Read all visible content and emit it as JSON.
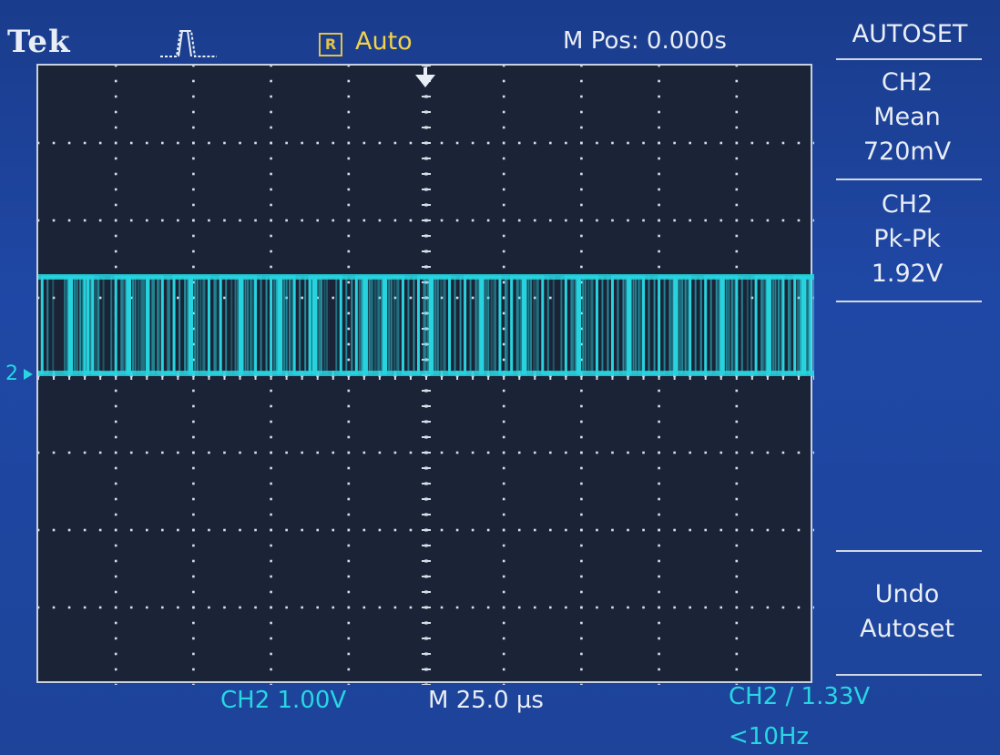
{
  "header": {
    "brand": "Tek",
    "trigger_icon": "pulse-icon",
    "run_state": "R",
    "acquisition": "Auto",
    "m_pos": "M Pos: 0.000s"
  },
  "menu": {
    "title": "AUTOSET",
    "measurements": [
      {
        "source": "CH2",
        "type": "Mean",
        "value": "720mV"
      },
      {
        "source": "CH2",
        "type": "Pk-Pk",
        "value": "1.92V"
      }
    ],
    "undo": {
      "line1": "Undo",
      "line2": "Autoset"
    }
  },
  "channel_marker": "2",
  "footer": {
    "ch_scale": "CH2  1.00V",
    "timebase": "M 25.0 µs",
    "trigger": "CH2 ∕ 1.33V",
    "freq": "<10Hz"
  },
  "colors": {
    "trace": "#27d3df",
    "acquisition": "#f2d24a",
    "readout": "#28d6e2",
    "bezel": "#1f48a6",
    "screen": "#1b2336"
  },
  "waveform": {
    "low_level_div": 4.0,
    "high_level_div": 4.0,
    "toggle_div": [
      0.05,
      0.4,
      0.43,
      0.6,
      0.64,
      0.7,
      1.0,
      1.15,
      1.18,
      1.4,
      1.42,
      1.6,
      1.75,
      1.95,
      1.98,
      2.2,
      2.35,
      2.6,
      2.63,
      2.8,
      3.0,
      3.1,
      3.13,
      3.3,
      3.5,
      3.55,
      3.58,
      3.9,
      4.1,
      4.2,
      4.23,
      4.45,
      4.48,
      4.7,
      4.9,
      5.05,
      5.08,
      5.3,
      5.5,
      5.7,
      5.73,
      5.95,
      6.1,
      6.25,
      6.28,
      6.5,
      6.8,
      6.95,
      6.98,
      7.2,
      7.4,
      7.6,
      7.63,
      7.8,
      8.0,
      8.2,
      8.23,
      8.4,
      8.6,
      8.8,
      8.83,
      9.0,
      9.25,
      9.4,
      9.43,
      9.6,
      9.75,
      9.85,
      9.88,
      9.95
    ]
  }
}
